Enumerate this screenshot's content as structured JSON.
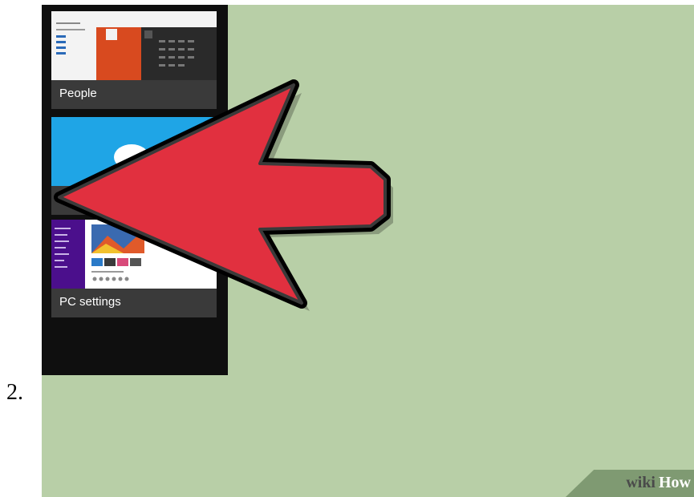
{
  "step": {
    "number": "2."
  },
  "apps": [
    {
      "label": "People",
      "icon": "people-app-thumbnail"
    },
    {
      "label": "",
      "icon": "skype-app-thumbnail"
    },
    {
      "label": "PC settings",
      "icon": "pc-settings-thumbnail"
    }
  ],
  "watermark": {
    "wiki": "wiki",
    "how": "How"
  },
  "colors": {
    "background": "#b8cfa7",
    "arrow": "#e1303f",
    "switcher": "#0f0f0f",
    "skype_blue": "#1fa5e6",
    "people_orange": "#d84a1f",
    "pc_purple": "#4b0f8c"
  }
}
